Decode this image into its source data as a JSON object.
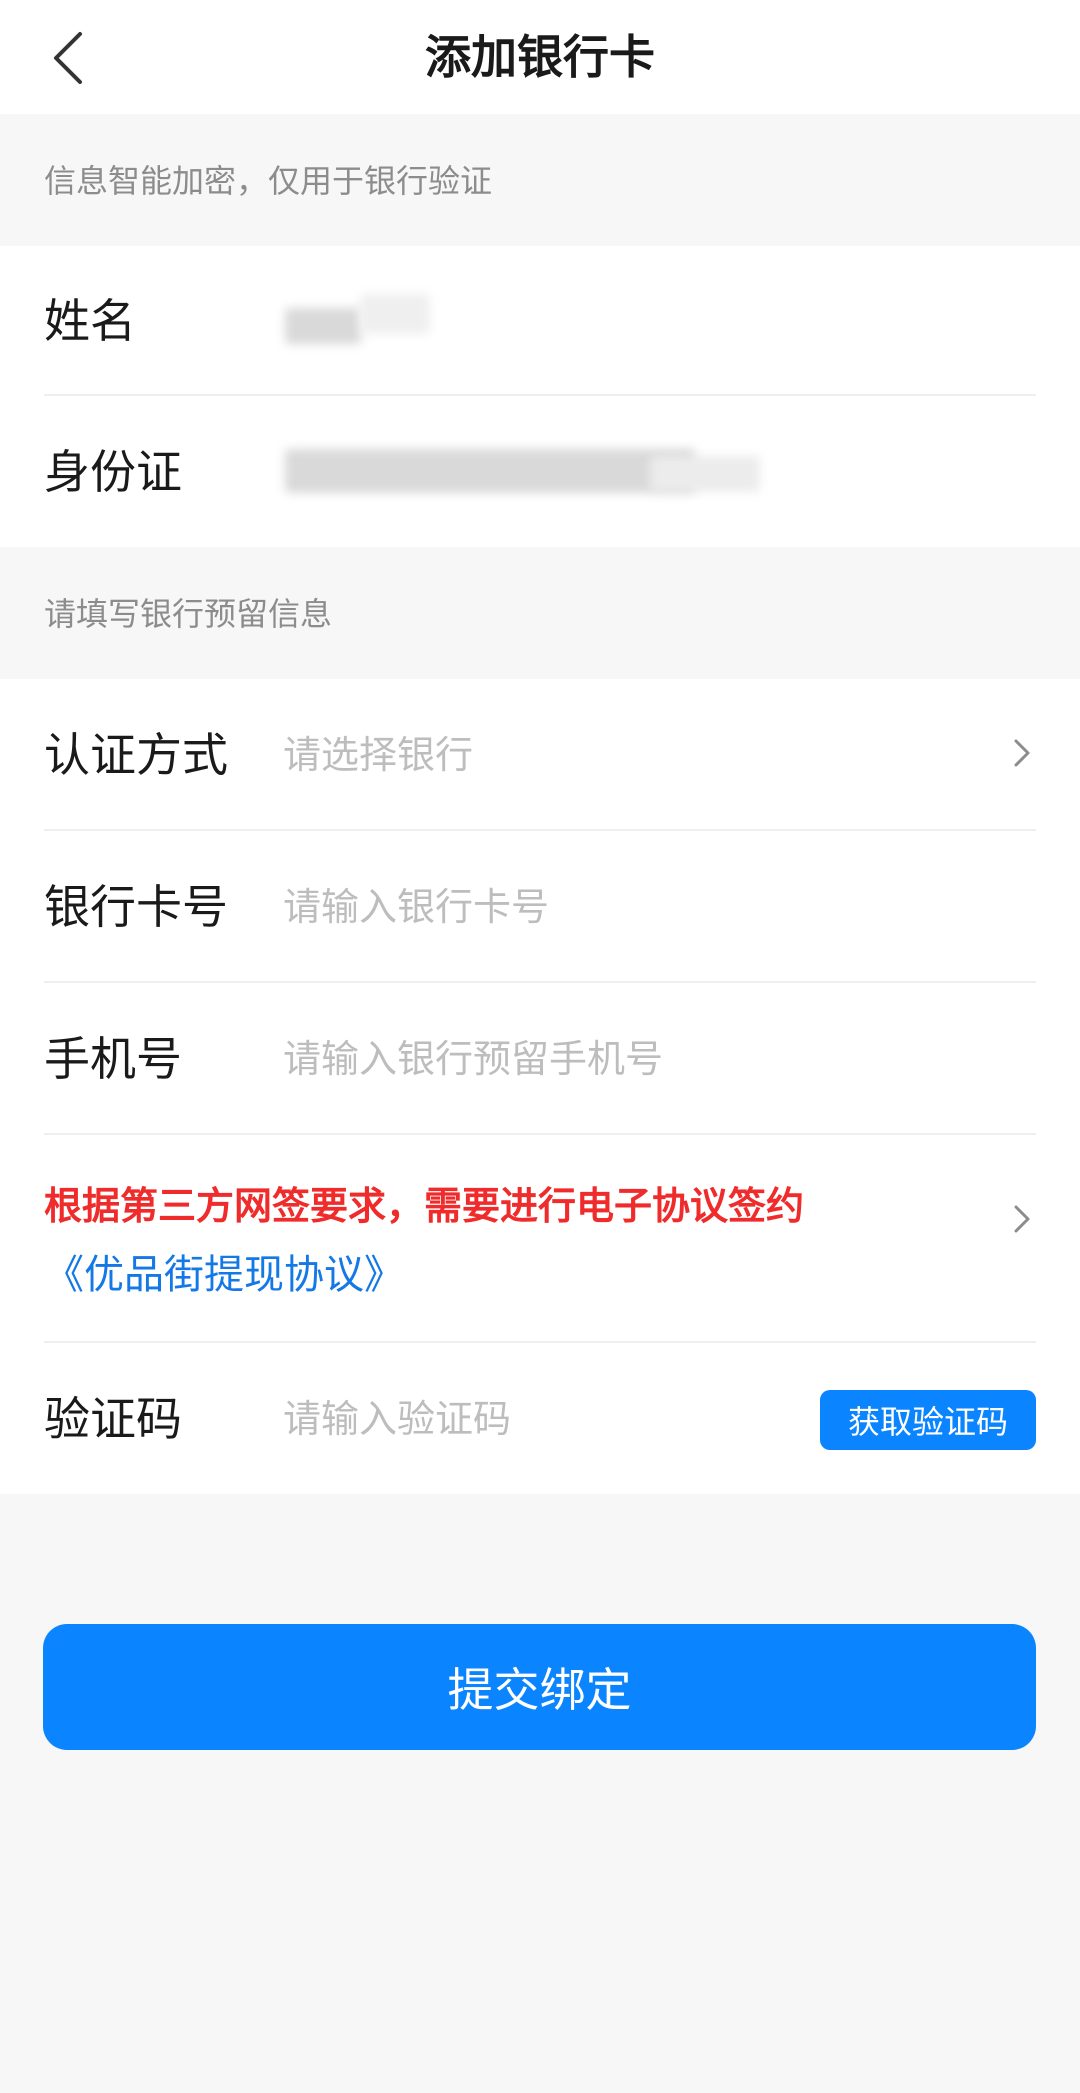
{
  "header": {
    "title": "添加银行卡",
    "back_icon": "chevron-left-icon"
  },
  "section_identity": {
    "hint": "信息智能加密，仅用于银行验证",
    "name_label": "姓名",
    "id_label": "身份证"
  },
  "section_bank": {
    "hint": "请填写银行预留信息",
    "auth_method": {
      "label": "认证方式",
      "placeholder": "请选择银行"
    },
    "card_number": {
      "label": "银行卡号",
      "placeholder": "请输入银行卡号"
    },
    "phone": {
      "label": "手机号",
      "placeholder": "请输入银行预留手机号"
    },
    "agreement": {
      "notice": "根据第三方网签要求，需要进行电子协议签约",
      "link": "《优品街提现协议》"
    },
    "verify_code": {
      "label": "验证码",
      "placeholder": "请输入验证码",
      "button": "获取验证码"
    }
  },
  "submit": {
    "label": "提交绑定"
  },
  "colors": {
    "primary": "#0a84ff",
    "link": "#1478e6",
    "warning": "#f02b2b",
    "background": "#f7f7f7",
    "hint_text": "#8c8c8c",
    "placeholder": "#bdbdbd"
  }
}
